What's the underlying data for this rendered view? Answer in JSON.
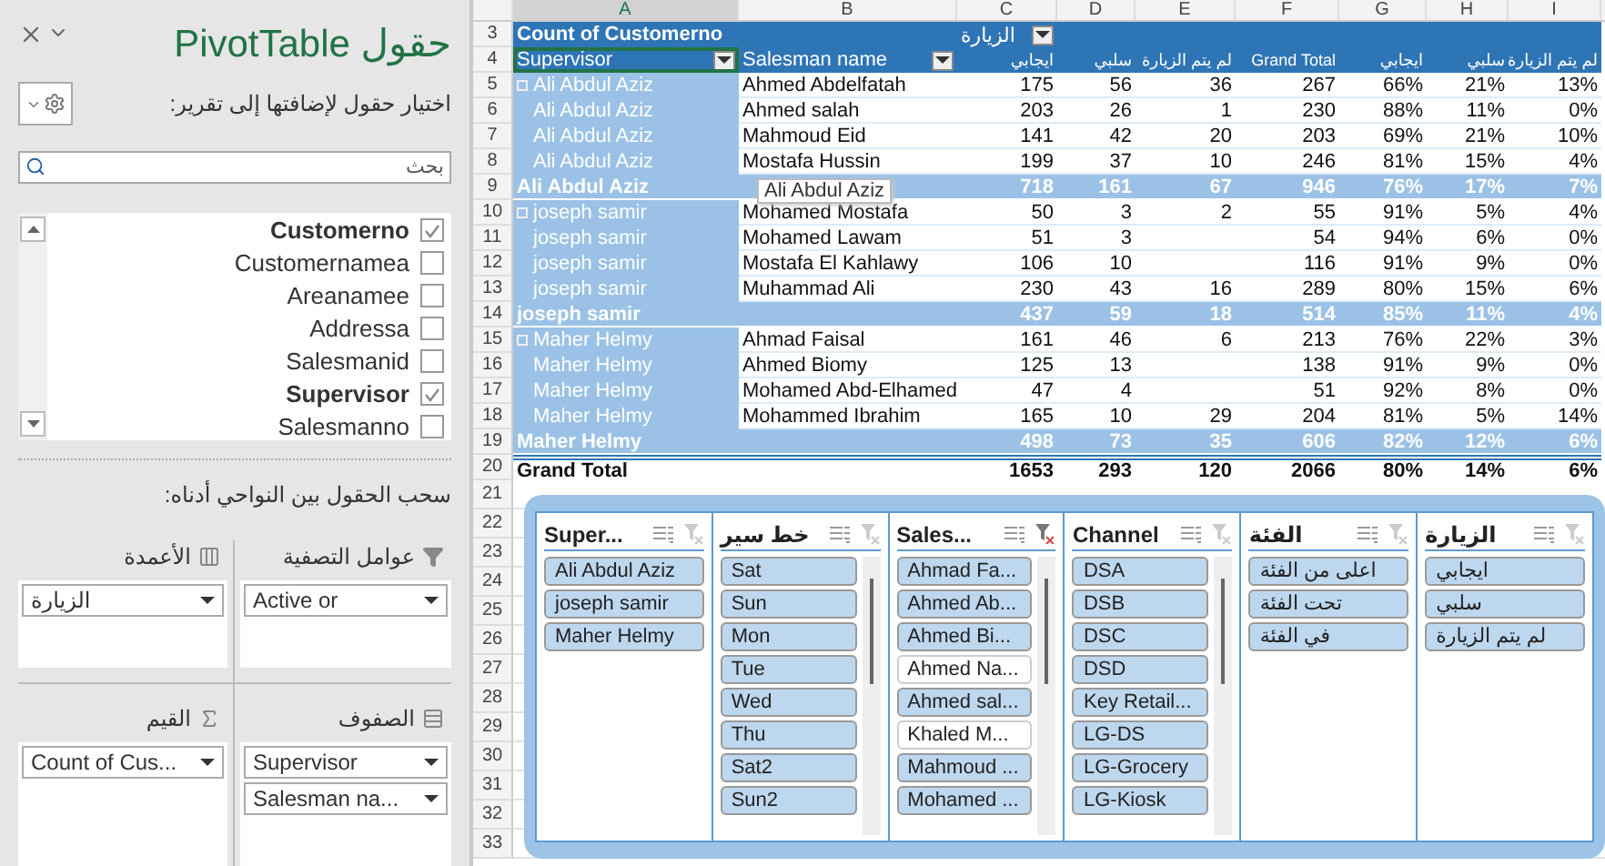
{
  "field_pane": {
    "title": "حقول PivotTable",
    "choose_label": "اختيار حقول لإضافتها إلى تقرير:",
    "search": {
      "placeholder": "بحث"
    },
    "fields": [
      {
        "name": "Customerno",
        "checked": true
      },
      {
        "name": "Customernamea",
        "checked": false
      },
      {
        "name": "Areanamee",
        "checked": false
      },
      {
        "name": "Addressa",
        "checked": false
      },
      {
        "name": "Salesmanid",
        "checked": false
      },
      {
        "name": "Supervisor",
        "checked": true
      },
      {
        "name": "Salesmanno",
        "checked": false
      }
    ],
    "drag_label": "سحب الحقول بين النواحي أدناه:",
    "areas": [
      {
        "kind": "columns",
        "title": "الأعمدة",
        "items": [
          "الزيارة"
        ]
      },
      {
        "kind": "filters",
        "title": "عوامل التصفية",
        "items": [
          "Active or"
        ]
      },
      {
        "kind": "values",
        "title": "القيم",
        "items": [
          "Count of Cus..."
        ]
      },
      {
        "kind": "rows",
        "title": "الصفوف",
        "items": [
          "Supervisor",
          "Salesman na..."
        ]
      }
    ]
  },
  "sheet": {
    "columns": [
      "A",
      "B",
      "C",
      "D",
      "E",
      "F",
      "G",
      "H",
      "I"
    ],
    "rows": [
      {
        "num": "3",
        "kind": "title",
        "cells": [
          "Count of Customerno",
          null,
          "الزيارة",
          null,
          null,
          null,
          null,
          null,
          null
        ]
      },
      {
        "num": "4",
        "kind": "labels",
        "cells": [
          "Supervisor",
          "Salesman name",
          "ايجابي",
          "سلبي",
          "لم يتم الزيارة",
          "Grand Total",
          "ايجابي",
          "سلبي",
          "لم يتم الزيارة"
        ]
      },
      {
        "num": "5",
        "kind": "detail",
        "collapse": true,
        "cells": [
          "Ali Abdul Aziz",
          "Ahmed Abdelfatah",
          "175",
          "56",
          "36",
          "267",
          "66%",
          "21%",
          "13%"
        ]
      },
      {
        "num": "6",
        "kind": "detail",
        "collapse": false,
        "cells": [
          "Ali Abdul Aziz",
          "Ahmed salah",
          "203",
          "26",
          "1",
          "230",
          "88%",
          "11%",
          "0%"
        ]
      },
      {
        "num": "7",
        "kind": "detail",
        "collapse": false,
        "cells": [
          "Ali Abdul Aziz",
          "Mahmoud Eid",
          "141",
          "42",
          "20",
          "203",
          "69%",
          "21%",
          "10%"
        ]
      },
      {
        "num": "8",
        "kind": "detail",
        "collapse": false,
        "cells": [
          "Ali Abdul Aziz",
          "Mostafa Hussin",
          "199",
          "37",
          "10",
          "246",
          "81%",
          "15%",
          "4%"
        ]
      },
      {
        "num": "9",
        "kind": "subtotal",
        "cells": [
          "Ali Abdul Aziz",
          null,
          "718",
          "161",
          "67",
          "946",
          "76%",
          "17%",
          "7%"
        ]
      },
      {
        "num": "10",
        "kind": "detail",
        "collapse": true,
        "cells": [
          "joseph samir",
          "Mohamed Mostafa",
          "50",
          "3",
          "2",
          "55",
          "91%",
          "5%",
          "4%"
        ]
      },
      {
        "num": "11",
        "kind": "detail",
        "collapse": false,
        "cells": [
          "joseph samir",
          "Mohamed Lawam",
          "51",
          "3",
          null,
          "54",
          "94%",
          "6%",
          "0%"
        ]
      },
      {
        "num": "12",
        "kind": "detail",
        "collapse": false,
        "cells": [
          "joseph samir",
          "Mostafa El Kahlawy",
          "106",
          "10",
          null,
          "116",
          "91%",
          "9%",
          "0%"
        ]
      },
      {
        "num": "13",
        "kind": "detail",
        "collapse": false,
        "cells": [
          "joseph samir",
          "Muhammad Ali",
          "230",
          "43",
          "16",
          "289",
          "80%",
          "15%",
          "6%"
        ]
      },
      {
        "num": "14",
        "kind": "subtotal",
        "cells": [
          "joseph samir",
          null,
          "437",
          "59",
          "18",
          "514",
          "85%",
          "11%",
          "4%"
        ]
      },
      {
        "num": "15",
        "kind": "detail",
        "collapse": true,
        "cells": [
          "Maher Helmy",
          "Ahmad Faisal",
          "161",
          "46",
          "6",
          "213",
          "76%",
          "22%",
          "3%"
        ]
      },
      {
        "num": "16",
        "kind": "detail",
        "collapse": false,
        "cells": [
          "Maher Helmy",
          "Ahmed Biomy",
          "125",
          "13",
          null,
          "138",
          "91%",
          "9%",
          "0%"
        ]
      },
      {
        "num": "17",
        "kind": "detail",
        "collapse": false,
        "cells": [
          "Maher Helmy",
          "Mohamed Abd-Elhamed",
          "47",
          "4",
          null,
          "51",
          "92%",
          "8%",
          "0%"
        ]
      },
      {
        "num": "18",
        "kind": "detail",
        "collapse": false,
        "cells": [
          "Maher Helmy",
          "Mohammed Ibrahim",
          "165",
          "10",
          "29",
          "204",
          "81%",
          "5%",
          "14%"
        ]
      },
      {
        "num": "19",
        "kind": "subtotal",
        "cells": [
          "Maher Helmy",
          null,
          "498",
          "73",
          "35",
          "606",
          "82%",
          "12%",
          "6%"
        ]
      },
      {
        "num": "20",
        "kind": "grand",
        "cells": [
          "Grand Total",
          null,
          "1653",
          "293",
          "120",
          "2066",
          "80%",
          "14%",
          "6%"
        ]
      }
    ],
    "more_rows": [
      "21",
      "22",
      "23",
      "24",
      "25",
      "26",
      "27",
      "28",
      "29",
      "30",
      "31",
      "32",
      "33"
    ]
  },
  "tooltip": "Ali Abdul Aziz",
  "slicers": [
    {
      "title": "Super...",
      "filtered": false,
      "scrollbar": false,
      "items": [
        {
          "label": "Ali Abdul Aziz",
          "selected": true
        },
        {
          "label": "joseph samir",
          "selected": true
        },
        {
          "label": "Maher Helmy",
          "selected": true
        }
      ]
    },
    {
      "title": "خط سير",
      "filtered": false,
      "scrollbar": true,
      "items": [
        {
          "label": "Sat",
          "selected": true
        },
        {
          "label": "Sun",
          "selected": true
        },
        {
          "label": "Mon",
          "selected": true
        },
        {
          "label": "Tue",
          "selected": true
        },
        {
          "label": "Wed",
          "selected": true
        },
        {
          "label": "Thu",
          "selected": true
        },
        {
          "label": "Sat2",
          "selected": true
        },
        {
          "label": "Sun2",
          "selected": true
        }
      ]
    },
    {
      "title": "Sales...",
      "filtered": true,
      "scrollbar": true,
      "items": [
        {
          "label": "Ahmad Fa...",
          "selected": true
        },
        {
          "label": "Ahmed Ab...",
          "selected": true
        },
        {
          "label": "Ahmed Bi...",
          "selected": true
        },
        {
          "label": "Ahmed Na...",
          "selected": false
        },
        {
          "label": "Ahmed sal...",
          "selected": true
        },
        {
          "label": "Khaled M...",
          "selected": false
        },
        {
          "label": "Mahmoud ...",
          "selected": true
        },
        {
          "label": "Mohamed ...",
          "selected": true
        }
      ]
    },
    {
      "title": "Channel",
      "filtered": false,
      "scrollbar": true,
      "items": [
        {
          "label": "DSA",
          "selected": true
        },
        {
          "label": "DSB",
          "selected": true
        },
        {
          "label": "DSC",
          "selected": true
        },
        {
          "label": "DSD",
          "selected": true
        },
        {
          "label": "Key Retail...",
          "selected": true
        },
        {
          "label": "LG-DS",
          "selected": true
        },
        {
          "label": "LG-Grocery",
          "selected": true
        },
        {
          "label": "LG-Kiosk",
          "selected": true
        }
      ]
    },
    {
      "title": "الفئة",
      "filtered": false,
      "scrollbar": false,
      "items": [
        {
          "label": "اعلى من الفئة",
          "selected": true
        },
        {
          "label": "تحت الفئة",
          "selected": true
        },
        {
          "label": "في الفئة",
          "selected": true
        }
      ]
    },
    {
      "title": "الزيارة",
      "filtered": false,
      "scrollbar": false,
      "items": [
        {
          "label": "ايجابي",
          "selected": true
        },
        {
          "label": "سلبي",
          "selected": true
        },
        {
          "label": "لم يتم الزيارة",
          "selected": true
        }
      ]
    }
  ]
}
